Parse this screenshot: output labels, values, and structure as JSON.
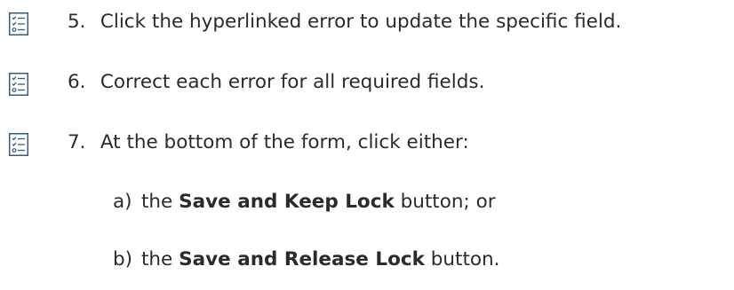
{
  "steps": [
    {
      "number": "5.",
      "text": "Click the hyperlinked error to update the specific field.",
      "icon": "checklist-icon"
    },
    {
      "number": "6.",
      "text": "Correct each error for all required fields.",
      "icon": "checklist-icon"
    },
    {
      "number": "7.",
      "text": "At the bottom of the form, click either:",
      "icon": "checklist-icon"
    }
  ],
  "sub_items": [
    {
      "letter": "a)",
      "prefix": "the",
      "button_name": "Save and Keep Lock",
      "suffix": "button; or"
    },
    {
      "letter": "b)",
      "prefix": "the",
      "button_name": "Save and Release Lock",
      "suffix": "button."
    }
  ],
  "colors": {
    "icon": "#3c5a78",
    "text": "#2b2b2b"
  }
}
